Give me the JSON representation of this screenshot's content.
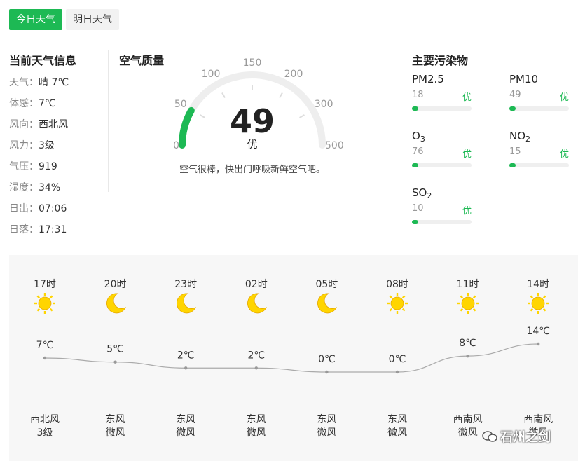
{
  "tabs": [
    {
      "label": "今日天气",
      "active": true
    },
    {
      "label": "明日天气",
      "active": false
    }
  ],
  "current": {
    "title": "当前天气信息",
    "rows": [
      {
        "key": "天气",
        "value": "晴 7℃"
      },
      {
        "key": "体感",
        "value": "7℃"
      },
      {
        "key": "风向",
        "value": "西北风"
      },
      {
        "key": "风力",
        "value": "3级"
      },
      {
        "key": "气压",
        "value": "919"
      },
      {
        "key": "湿度",
        "value": "34%"
      },
      {
        "key": "日出",
        "value": "07:06"
      },
      {
        "key": "日落",
        "value": "17:31"
      }
    ]
  },
  "aqi": {
    "title": "空气质量",
    "value": 49,
    "value_text": "49",
    "level": "优",
    "scale": [
      "0",
      "50",
      "100",
      "150",
      "200",
      "300",
      "500"
    ],
    "description": "空气很棒，快出门呼吸新鲜空气吧。",
    "color": "#1db954"
  },
  "pollutants": {
    "title": "主要污染物",
    "items": [
      {
        "name": "PM2.5",
        "sub": "",
        "value": "18",
        "level": "优",
        "fill": 0.1
      },
      {
        "name": "PM10",
        "sub": "",
        "value": "49",
        "level": "优",
        "fill": 0.1
      },
      {
        "name": "O",
        "sub": "3",
        "value": "76",
        "level": "优",
        "fill": 0.1
      },
      {
        "name": "NO",
        "sub": "2",
        "value": "15",
        "level": "优",
        "fill": 0.1
      },
      {
        "name": "SO",
        "sub": "2",
        "value": "10",
        "level": "优",
        "fill": 0.1
      }
    ]
  },
  "forecast": {
    "hours": [
      {
        "time": "17时",
        "icon": "sun-icon",
        "temp": 7,
        "temp_text": "7℃",
        "wind_dir": "西北风",
        "wind_level": "3级"
      },
      {
        "time": "20时",
        "icon": "moon-icon",
        "temp": 5,
        "temp_text": "5℃",
        "wind_dir": "东风",
        "wind_level": "微风"
      },
      {
        "time": "23时",
        "icon": "moon-icon",
        "temp": 2,
        "temp_text": "2℃",
        "wind_dir": "东风",
        "wind_level": "微风"
      },
      {
        "time": "02时",
        "icon": "moon-icon",
        "temp": 2,
        "temp_text": "2℃",
        "wind_dir": "东风",
        "wind_level": "微风"
      },
      {
        "time": "05时",
        "icon": "moon-icon",
        "temp": 0,
        "temp_text": "0℃",
        "wind_dir": "东风",
        "wind_level": "微风"
      },
      {
        "time": "08时",
        "icon": "sun-icon",
        "temp": 0,
        "temp_text": "0℃",
        "wind_dir": "东风",
        "wind_level": "微风"
      },
      {
        "time": "11时",
        "icon": "sun-icon",
        "temp": 8,
        "temp_text": "8℃",
        "wind_dir": "西南风",
        "wind_level": "微风"
      },
      {
        "time": "14时",
        "icon": "sun-icon",
        "temp": 14,
        "temp_text": "14℃",
        "wind_dir": "西南风",
        "wind_level": "微风"
      }
    ]
  },
  "watermark": "石州之剑",
  "colors": {
    "accent": "#1db954",
    "sun": "#ffd500",
    "moon": "#ffd500"
  }
}
